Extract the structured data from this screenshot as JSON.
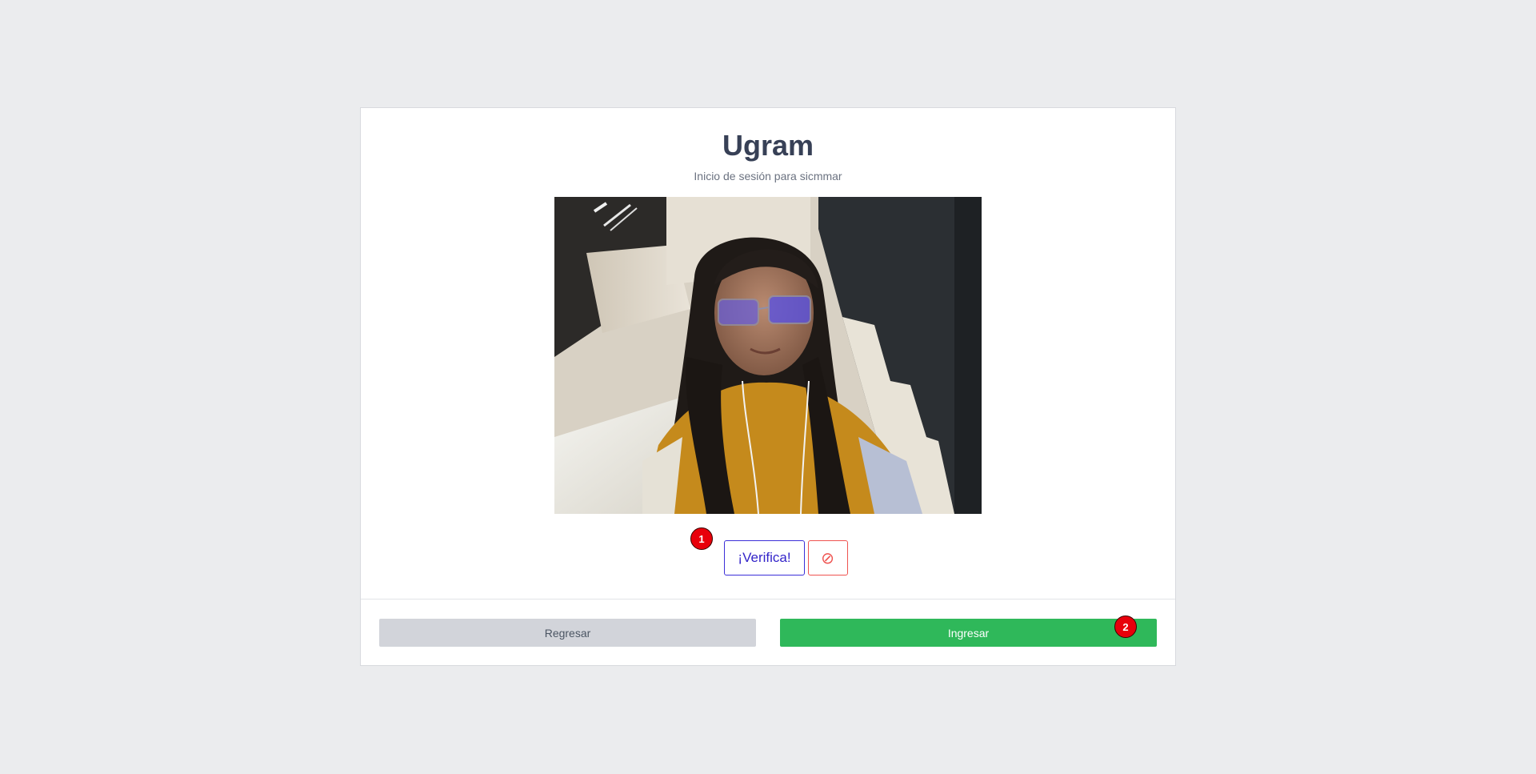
{
  "card": {
    "title": "Ugram",
    "subtitle": "Inicio de sesión para sicmmar"
  },
  "camera": {
    "description_icon": "webcam-feed"
  },
  "actions": {
    "verify_label": "¡Verifica!",
    "cancel_icon": "⊘"
  },
  "footer": {
    "back_label": "Regresar",
    "login_label": "Ingresar"
  },
  "badges": {
    "first": "1",
    "second": "2"
  },
  "colors": {
    "background": "#ebecee",
    "title": "#374056",
    "verify": "#3b2fd8",
    "cancel": "#ef5350",
    "back": "#d2d4da",
    "login": "#2fb85a",
    "badge": "#e8000b"
  }
}
